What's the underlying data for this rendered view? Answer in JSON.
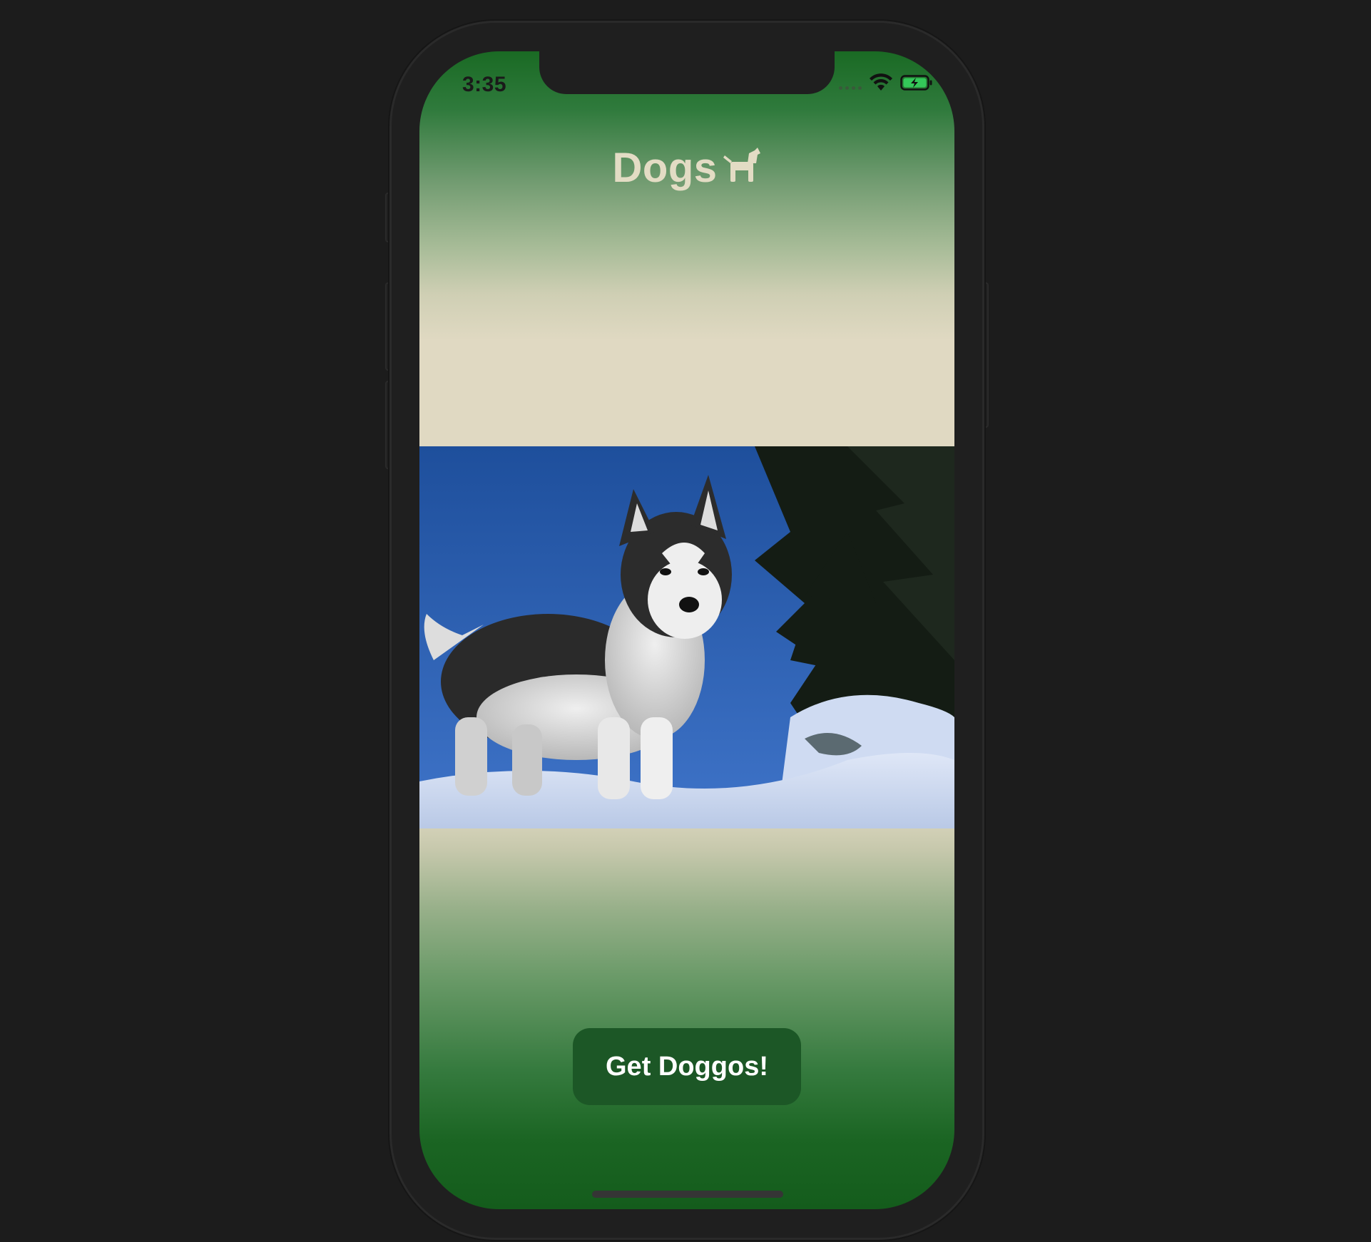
{
  "status_bar": {
    "time": "3:35",
    "icons": [
      "signal-dots-icon",
      "wifi-icon",
      "battery-charging-icon"
    ],
    "battery_color": "#34c759"
  },
  "header": {
    "title": "Dogs",
    "icon": "dog-icon"
  },
  "main": {
    "image": {
      "subject": "dog photo"
    }
  },
  "action": {
    "button_label": "Get Doggos!"
  },
  "colors": {
    "gradient_top": "#1a6a24",
    "gradient_middle": "#e0d9c2",
    "button_bg": "#1c5726",
    "title_color": "#e3dcc4",
    "device_background": "#1c1c1c"
  }
}
